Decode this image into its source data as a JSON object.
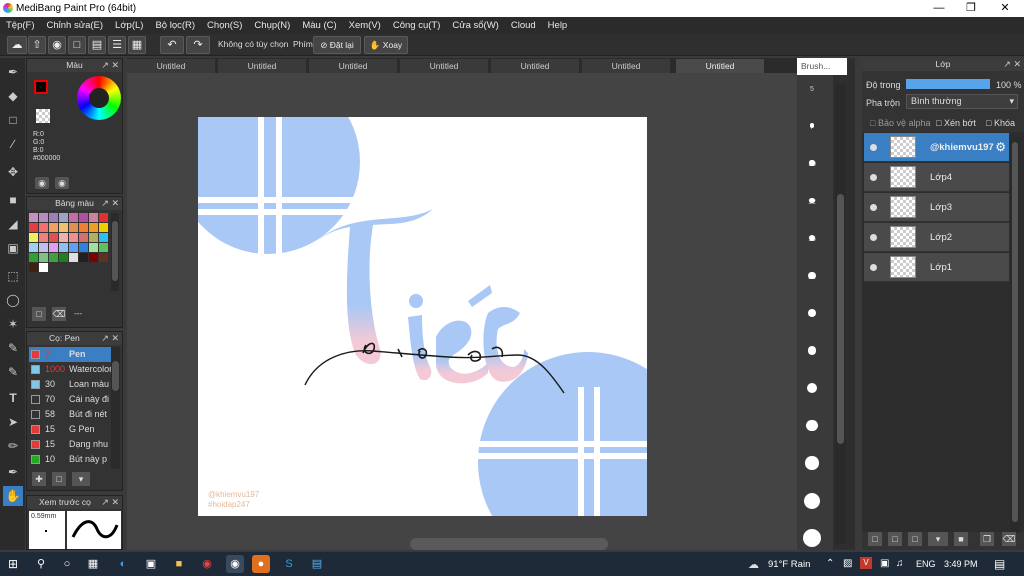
{
  "window": {
    "title": "MediBang Paint Pro (64bit)"
  },
  "menu": [
    "Tệp(F)",
    "Chỉnh sửa(E)",
    "Lớp(L)",
    "Bộ lọc(R)",
    "Chọn(S)",
    "Chụp(N)",
    "Màu (C)",
    "Xem(V)",
    "Công cụ(T)",
    "Cửa sổ(W)",
    "Cloud",
    "Help"
  ],
  "toolbar": {
    "option_label": "Không có tùy chọn",
    "phim_label": "Phím",
    "reset_label": "Đặt lại",
    "rotate_label": "Xoay"
  },
  "color_panel": {
    "title": "Màu",
    "r": "R:0",
    "g": "G:0",
    "b": "B:0",
    "hex": "#000000"
  },
  "palette_panel": {
    "title": "Bảng màu",
    "dash": "---"
  },
  "brush_list_panel": {
    "title": "Cọ: Pen",
    "items": [
      {
        "size": "7",
        "name": "Pen",
        "color": "#e23b3b"
      },
      {
        "size": "1000",
        "name": "Watercolor",
        "color": "#7fc8e8"
      },
      {
        "size": "30",
        "name": "Loan màu",
        "color": "#7fc8e8"
      },
      {
        "size": "70",
        "name": "Cái này đi",
        "color": "#333333"
      },
      {
        "size": "58",
        "name": "Bút đi nét",
        "color": "#333333"
      },
      {
        "size": "15",
        "name": "G Pen",
        "color": "#e23b3b"
      },
      {
        "size": "15",
        "name": "Dạng nhu",
        "color": "#e23b3b"
      },
      {
        "size": "10",
        "name": "Bút này p",
        "color": "#22aa22"
      }
    ]
  },
  "preview_panel": {
    "title": "Xem trước cọ",
    "size": "0.59mm"
  },
  "tabs": [
    "Untitled",
    "Untitled",
    "Untitled",
    "Untitled",
    "Untitled",
    "Untitled",
    "Untitled"
  ],
  "canvas": {
    "watermark1": "@khiemvu197",
    "watermark2": "#hoidap247"
  },
  "brush_panel": {
    "title": "Brush...",
    "sizes": [
      "5",
      "7",
      "10",
      "12",
      "15",
      "20",
      "25",
      "30",
      "40",
      "50",
      "70",
      "100",
      "150"
    ]
  },
  "layer_panel": {
    "title": "Lớp",
    "opacity_label": "Độ trong",
    "opacity_value": "100 %",
    "blend_label": "Pha trộn",
    "blend_value": "Bình thường",
    "protect_alpha": "Bảo vệ alpha",
    "clipping": "Xén bớt",
    "lock": "Khóa",
    "layers": [
      "@khiemvu197",
      "Lớp4",
      "Lớp3",
      "Lớp2",
      "Lớp1"
    ]
  },
  "taskbar": {
    "weather": "91°F Rain",
    "lang": "ENG",
    "time": "3:49 PM"
  },
  "colors": {
    "accent": "#3a7fc4",
    "art_blue": "#a9c8f5",
    "art_pink": "#f3c9d6"
  }
}
